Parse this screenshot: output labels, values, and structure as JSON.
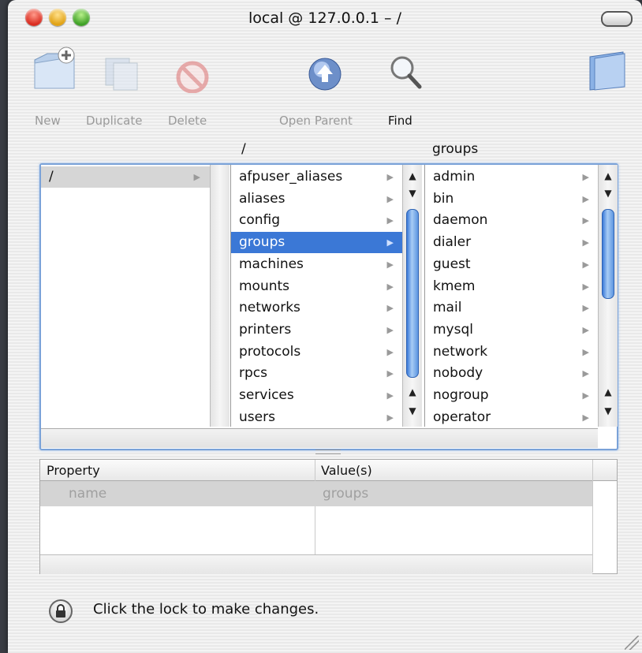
{
  "window": {
    "title": "local @ 127.0.0.1 – /"
  },
  "toolbar": {
    "new_label": "New",
    "duplicate_label": "Duplicate",
    "delete_label": "Delete",
    "open_parent_label": "Open Parent",
    "find_label": "Find"
  },
  "browser": {
    "column2_header": "/",
    "column3_header": "groups",
    "column1": [
      "/"
    ],
    "column2": [
      "afpuser_aliases",
      "aliases",
      "config",
      "groups",
      "machines",
      "mounts",
      "networks",
      "printers",
      "protocols",
      "rpcs",
      "services",
      "users"
    ],
    "column2_selected": "groups",
    "column3": [
      "admin",
      "bin",
      "daemon",
      "dialer",
      "guest",
      "kmem",
      "mail",
      "mysql",
      "network",
      "nobody",
      "nogroup",
      "operator"
    ]
  },
  "properties": {
    "col_property": "Property",
    "col_values": "Value(s)",
    "rows": [
      {
        "property": "name",
        "value": "groups"
      }
    ]
  },
  "footer": {
    "lock_message": "Click the lock to make changes."
  },
  "colors": {
    "selection": "#3b78d6",
    "accent": "#7aa2d8"
  }
}
